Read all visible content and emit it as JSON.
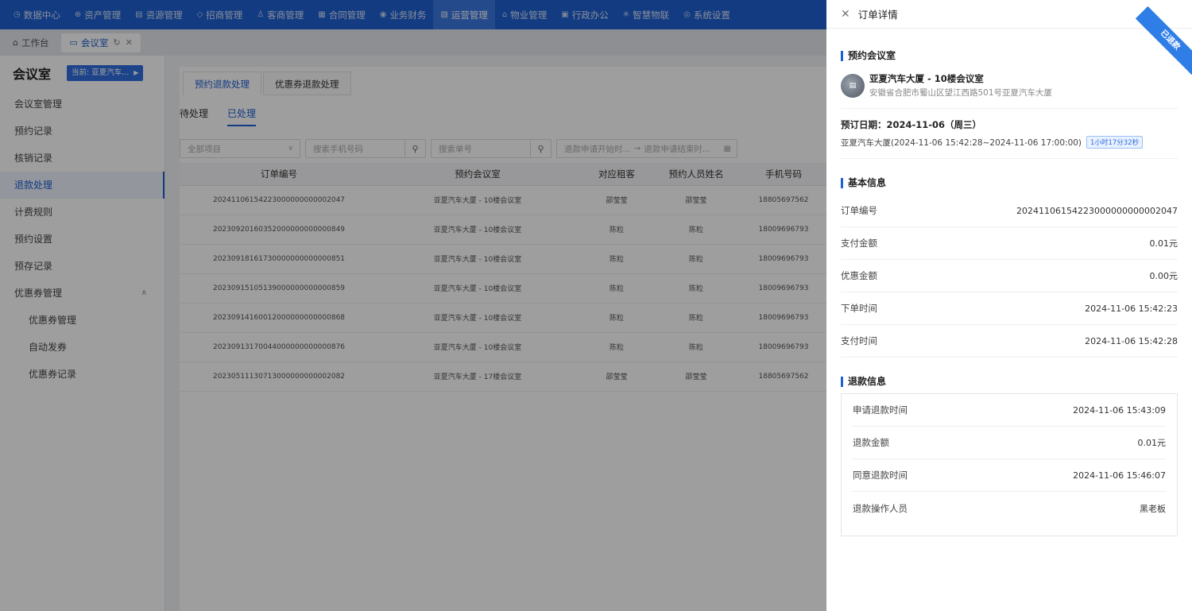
{
  "topnav": [
    {
      "icon": "dashboard-icon",
      "glyph": "◷",
      "label": "数据中心"
    },
    {
      "icon": "asset-icon",
      "glyph": "⊕",
      "label": "资产管理"
    },
    {
      "icon": "resource-icon",
      "glyph": "▤",
      "label": "资源管理"
    },
    {
      "icon": "tag-icon",
      "glyph": "◇",
      "label": "招商管理"
    },
    {
      "icon": "customer-icon",
      "glyph": "♙",
      "label": "客商管理"
    },
    {
      "icon": "contract-icon",
      "glyph": "▦",
      "label": "合同管理"
    },
    {
      "icon": "finance-icon",
      "glyph": "◉",
      "label": "业务财务"
    },
    {
      "icon": "operations-icon",
      "glyph": "▧",
      "label": "运营管理",
      "active": true
    },
    {
      "icon": "property-icon",
      "glyph": "⌂",
      "label": "物业管理"
    },
    {
      "icon": "office-icon",
      "glyph": "▣",
      "label": "行政办公"
    },
    {
      "icon": "iot-icon",
      "glyph": "✳",
      "label": "智慧物联"
    },
    {
      "icon": "settings-icon",
      "glyph": "◎",
      "label": "系统设置"
    }
  ],
  "tabs": {
    "workbench": "工作台",
    "meeting_room": "会议室"
  },
  "sidebar": {
    "title": "会议室",
    "current": "当前: 亚夏汽车...",
    "items": [
      "会议室管理",
      "预约记录",
      "核销记录",
      "退款处理",
      "计费规则",
      "预约设置",
      "预存记录",
      "优惠券管理"
    ],
    "subitems": [
      "优惠券管理",
      "自动发券",
      "优惠券记录"
    ]
  },
  "main": {
    "subtabs": [
      "预约退款处理",
      "优惠券退款处理"
    ],
    "status_tabs": [
      "待处理",
      "已处理"
    ],
    "filters": {
      "project": "全部项目",
      "phone_placeholder": "搜索手机号码",
      "order_placeholder": "搜索单号",
      "date_start": "退款申请开始时...",
      "date_sep": "→",
      "date_end": "退款申请结束时..."
    },
    "columns": [
      "订单编号",
      "预约会议室",
      "对应租客",
      "预约人员姓名",
      "手机号码"
    ],
    "rows": [
      [
        "20241106154223000000000002047",
        "亚夏汽车大厦 - 10楼会议室",
        "邵莹莹",
        "邵莹莹",
        "18805697562"
      ],
      [
        "20230920160352000000000000849",
        "亚夏汽车大厦 - 10楼会议室",
        "陈粒",
        "陈粒",
        "18009696793"
      ],
      [
        "20230918161730000000000000851",
        "亚夏汽车大厦 - 10楼会议室",
        "陈粒",
        "陈粒",
        "18009696793"
      ],
      [
        "20230915105139000000000000859",
        "亚夏汽车大厦 - 10楼会议室",
        "陈粒",
        "陈粒",
        "18009696793"
      ],
      [
        "20230914160012000000000000868",
        "亚夏汽车大厦 - 10楼会议室",
        "陈粒",
        "陈粒",
        "18009696793"
      ],
      [
        "20230913170044000000000000876",
        "亚夏汽车大厦 - 10楼会议室",
        "陈粒",
        "陈粒",
        "18009696793"
      ],
      [
        "20230511130713000000000002082",
        "亚夏汽车大厦 - 17楼会议室",
        "邵莹莹",
        "邵莹莹",
        "18805697562"
      ]
    ]
  },
  "drawer": {
    "title": "订单详情",
    "ribbon": "已退款",
    "section_booking": "预约会议室",
    "room_name": "亚夏汽车大厦 - 10楼会议室",
    "room_address": "安徽省合肥市蜀山区望江西路501号亚夏汽车大厦",
    "booking_date": "预订日期：2024-11-06（周三）",
    "booking_time": "亚夏汽车大厦(2024-11-06 15:42:28~2024-11-06 17:00:00)",
    "booking_duration": "1小时17分32秒",
    "section_basic": "基本信息",
    "basic": [
      {
        "k": "订单编号",
        "v": "20241106154223000000000002047"
      },
      {
        "k": "支付金额",
        "v": "0.01元"
      },
      {
        "k": "优惠金额",
        "v": "0.00元"
      },
      {
        "k": "下单时间",
        "v": "2024-11-06 15:42:23"
      },
      {
        "k": "支付时间",
        "v": "2024-11-06 15:42:28"
      }
    ],
    "section_refund": "退款信息",
    "refund": [
      {
        "k": "申请退款时间",
        "v": "2024-11-06 15:43:09"
      },
      {
        "k": "退款金额",
        "v": "0.01元"
      },
      {
        "k": "同意退款时间",
        "v": "2024-11-06 15:46:07"
      },
      {
        "k": "退款操作人员",
        "v": "黑老板"
      }
    ]
  },
  "colors": {
    "brand": "#1e5fd1",
    "ribbon": "#2f7de6"
  }
}
